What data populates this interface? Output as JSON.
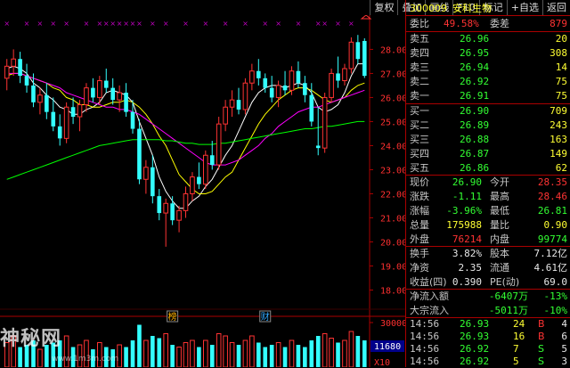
{
  "toolbar": {
    "buttons": [
      "复权",
      "叠加",
      "画线",
      "F10",
      "标记",
      "+自选",
      "返回"
    ]
  },
  "stock": {
    "code": "300009",
    "name": "安科生物"
  },
  "order_book": {
    "webi_label": "委比",
    "webi_value": "49.58%",
    "weicha_label": "委差",
    "weicha_value": "879",
    "asks": [
      {
        "label": "卖五",
        "price": "26.96",
        "vol": "20"
      },
      {
        "label": "卖四",
        "price": "26.95",
        "vol": "308"
      },
      {
        "label": "卖三",
        "price": "26.94",
        "vol": "14"
      },
      {
        "label": "卖二",
        "price": "26.92",
        "vol": "75"
      },
      {
        "label": "卖一",
        "price": "26.91",
        "vol": "75"
      }
    ],
    "bids": [
      {
        "label": "买一",
        "price": "26.90",
        "vol": "709"
      },
      {
        "label": "买二",
        "price": "26.89",
        "vol": "243"
      },
      {
        "label": "买三",
        "price": "26.88",
        "vol": "163"
      },
      {
        "label": "买四",
        "price": "26.87",
        "vol": "149"
      },
      {
        "label": "买五",
        "price": "26.86",
        "vol": "62"
      }
    ]
  },
  "quote": {
    "rows": [
      {
        "l1": "现价",
        "v1": "26.90",
        "l2": "今开",
        "v2": "28.35"
      },
      {
        "l1": "涨跌",
        "v1": "-1.11",
        "l2": "最高",
        "v2": "28.46"
      },
      {
        "l1": "涨幅",
        "v1": "-3.96%",
        "l2": "最低",
        "v2": "26.81"
      },
      {
        "l1": "总量",
        "v1": "175988",
        "l2": "量比",
        "v2": "0.90"
      },
      {
        "l1": "外盘",
        "v1": "76214",
        "l2": "内盘",
        "v2": "99774"
      }
    ]
  },
  "fundamentals": {
    "rows": [
      {
        "l1": "换手",
        "v1": "3.82%",
        "l2": "股本",
        "v2": "7.12亿"
      },
      {
        "l1": "净资",
        "v1": "2.35",
        "l2": "流通",
        "v2": "4.61亿"
      },
      {
        "l1": "收益(四)",
        "v1": "0.390",
        "l2": "PE(动)",
        "v2": "69.0"
      }
    ]
  },
  "flows": {
    "rows": [
      {
        "label": "净流入额",
        "value": "-6407万",
        "pct": "-13%"
      },
      {
        "label": "大宗流入",
        "value": "-5011万",
        "pct": "-10%"
      }
    ]
  },
  "ticks": [
    {
      "time": "14:56",
      "price": "26.93",
      "vol": "24",
      "side": "B",
      "n": "4"
    },
    {
      "time": "14:56",
      "price": "26.93",
      "vol": "16",
      "side": "B",
      "n": "6"
    },
    {
      "time": "14:56",
      "price": "26.92",
      "vol": "7",
      "side": "S",
      "n": "5"
    },
    {
      "time": "14:56",
      "price": "26.92",
      "vol": "5",
      "side": "S",
      "n": "3"
    }
  ],
  "price_axis": [
    "28.00",
    "27.00",
    "26.00",
    "25.00",
    "24.00",
    "23.00",
    "22.00",
    "21.00",
    "20.00",
    "19.00",
    "18.00"
  ],
  "volume_axis": [
    "30000",
    "11680",
    "X10"
  ],
  "event_markers": [
    "榜",
    "财"
  ],
  "watermark": {
    "main": "神秘网",
    "sub": "www.1m3m.com"
  },
  "colors": {
    "up": "#ff3333",
    "down": "#33ffff",
    "ma5": "#ffffff",
    "ma10": "#ffff00",
    "ma20": "#ff00ff",
    "ma60": "#00ff00"
  },
  "chart_data": {
    "type": "candlestick",
    "ylim": [
      17.5,
      29.2
    ],
    "candles": [
      {
        "o": 26.8,
        "h": 27.6,
        "l": 26.3,
        "c": 27.3
      },
      {
        "o": 27.3,
        "h": 28.0,
        "l": 26.9,
        "c": 27.6
      },
      {
        "o": 27.6,
        "h": 27.9,
        "l": 26.6,
        "c": 26.9
      },
      {
        "o": 26.9,
        "h": 27.4,
        "l": 26.2,
        "c": 26.5
      },
      {
        "o": 26.5,
        "h": 27.0,
        "l": 25.6,
        "c": 25.8
      },
      {
        "o": 25.8,
        "h": 26.4,
        "l": 25.3,
        "c": 26.1
      },
      {
        "o": 26.1,
        "h": 26.6,
        "l": 25.1,
        "c": 25.4
      },
      {
        "o": 25.4,
        "h": 26.0,
        "l": 24.6,
        "c": 24.8
      },
      {
        "o": 24.8,
        "h": 25.3,
        "l": 24.0,
        "c": 24.3
      },
      {
        "o": 24.3,
        "h": 25.8,
        "l": 24.1,
        "c": 25.6
      },
      {
        "o": 25.6,
        "h": 26.0,
        "l": 24.9,
        "c": 25.2
      },
      {
        "o": 25.2,
        "h": 25.9,
        "l": 24.6,
        "c": 25.7
      },
      {
        "o": 25.7,
        "h": 26.6,
        "l": 25.4,
        "c": 26.4
      },
      {
        "o": 26.4,
        "h": 26.8,
        "l": 25.8,
        "c": 26.0
      },
      {
        "o": 26.0,
        "h": 26.9,
        "l": 25.7,
        "c": 26.7
      },
      {
        "o": 26.7,
        "h": 27.2,
        "l": 26.2,
        "c": 26.4
      },
      {
        "o": 26.4,
        "h": 26.8,
        "l": 25.7,
        "c": 25.9
      },
      {
        "o": 25.9,
        "h": 26.5,
        "l": 25.4,
        "c": 26.2
      },
      {
        "o": 26.2,
        "h": 26.6,
        "l": 25.2,
        "c": 25.4
      },
      {
        "o": 25.4,
        "h": 25.9,
        "l": 24.5,
        "c": 24.7
      },
      {
        "o": 24.7,
        "h": 25.1,
        "l": 22.4,
        "c": 22.6
      },
      {
        "o": 22.6,
        "h": 23.4,
        "l": 22.0,
        "c": 23.1
      },
      {
        "o": 23.1,
        "h": 23.6,
        "l": 21.6,
        "c": 21.9
      },
      {
        "o": 21.9,
        "h": 22.2,
        "l": 20.9,
        "c": 21.2
      },
      {
        "o": 21.2,
        "h": 21.8,
        "l": 19.8,
        "c": 21.6
      },
      {
        "o": 21.6,
        "h": 21.9,
        "l": 20.7,
        "c": 20.9
      },
      {
        "o": 20.9,
        "h": 21.5,
        "l": 20.4,
        "c": 21.3
      },
      {
        "o": 21.3,
        "h": 22.3,
        "l": 21.0,
        "c": 22.0
      },
      {
        "o": 22.0,
        "h": 22.9,
        "l": 21.7,
        "c": 22.7
      },
      {
        "o": 22.7,
        "h": 23.3,
        "l": 22.2,
        "c": 22.4
      },
      {
        "o": 22.4,
        "h": 23.8,
        "l": 22.2,
        "c": 23.6
      },
      {
        "o": 23.6,
        "h": 24.2,
        "l": 23.0,
        "c": 23.2
      },
      {
        "o": 23.2,
        "h": 25.2,
        "l": 23.0,
        "c": 24.9
      },
      {
        "o": 24.9,
        "h": 25.9,
        "l": 24.6,
        "c": 25.6
      },
      {
        "o": 25.6,
        "h": 26.3,
        "l": 25.2,
        "c": 25.9
      },
      {
        "o": 25.9,
        "h": 26.4,
        "l": 25.3,
        "c": 25.5
      },
      {
        "o": 25.5,
        "h": 26.8,
        "l": 25.3,
        "c": 26.6
      },
      {
        "o": 26.6,
        "h": 27.4,
        "l": 26.3,
        "c": 27.1
      },
      {
        "o": 27.1,
        "h": 27.6,
        "l": 26.5,
        "c": 26.8
      },
      {
        "o": 26.8,
        "h": 27.0,
        "l": 26.2,
        "c": 26.4
      },
      {
        "o": 26.4,
        "h": 26.9,
        "l": 25.8,
        "c": 26.0
      },
      {
        "o": 26.0,
        "h": 26.7,
        "l": 25.6,
        "c": 26.5
      },
      {
        "o": 26.5,
        "h": 27.1,
        "l": 26.1,
        "c": 26.3
      },
      {
        "o": 26.3,
        "h": 27.3,
        "l": 26.1,
        "c": 27.1
      },
      {
        "o": 27.1,
        "h": 27.5,
        "l": 26.4,
        "c": 26.6
      },
      {
        "o": 26.6,
        "h": 26.9,
        "l": 25.8,
        "c": 26.1
      },
      {
        "o": 26.1,
        "h": 26.6,
        "l": 24.8,
        "c": 25.0
      },
      {
        "o": 24.0,
        "h": 25.6,
        "l": 23.6,
        "c": 23.9
      },
      {
        "o": 23.9,
        "h": 26.2,
        "l": 23.7,
        "c": 26.0
      },
      {
        "o": 26.0,
        "h": 27.2,
        "l": 25.8,
        "c": 27.0
      },
      {
        "o": 27.0,
        "h": 27.7,
        "l": 26.4,
        "c": 26.7
      },
      {
        "o": 26.7,
        "h": 27.4,
        "l": 26.5,
        "c": 27.2
      },
      {
        "o": 27.2,
        "h": 28.5,
        "l": 27.0,
        "c": 28.3
      },
      {
        "o": 28.3,
        "h": 28.6,
        "l": 27.4,
        "c": 27.6
      },
      {
        "o": 28.35,
        "h": 28.46,
        "l": 26.81,
        "c": 26.9
      }
    ],
    "volumes": [
      0.55,
      0.7,
      0.45,
      0.5,
      0.6,
      0.4,
      0.5,
      0.55,
      0.6,
      0.7,
      0.45,
      0.5,
      0.6,
      0.4,
      0.55,
      0.45,
      0.4,
      0.5,
      0.45,
      0.6,
      0.95,
      0.6,
      0.7,
      0.65,
      0.75,
      0.5,
      0.45,
      0.55,
      0.6,
      0.45,
      0.6,
      0.5,
      0.75,
      0.7,
      0.55,
      0.5,
      0.6,
      0.7,
      0.55,
      0.45,
      0.5,
      0.55,
      0.45,
      0.6,
      0.5,
      0.45,
      0.6,
      0.7,
      0.75,
      0.65,
      0.55,
      0.6,
      0.8,
      0.7,
      0.6
    ],
    "ma": [
      {
        "name": "MA5",
        "color": "#ffffff",
        "values": [
          27.2,
          27.3,
          27.2,
          27.0,
          26.6,
          26.4,
          26.1,
          25.9,
          25.6,
          25.5,
          25.3,
          25.3,
          25.5,
          25.6,
          25.8,
          26.2,
          26.3,
          26.2,
          26.1,
          25.8,
          25.0,
          24.3,
          23.6,
          22.7,
          22.1,
          21.7,
          21.4,
          21.4,
          21.7,
          21.9,
          22.3,
          22.6,
          23.1,
          23.6,
          24.0,
          24.6,
          25.2,
          25.8,
          26.2,
          26.4,
          26.5,
          26.5,
          26.4,
          26.5,
          26.6,
          26.5,
          26.2,
          25.6,
          25.4,
          25.5,
          25.7,
          26.2,
          26.9,
          27.4,
          27.4
        ]
      },
      {
        "name": "MA10",
        "color": "#ffff00",
        "values": [
          26.9,
          27.0,
          27.0,
          26.9,
          26.8,
          26.7,
          26.6,
          26.4,
          26.3,
          26.0,
          25.9,
          25.7,
          25.7,
          25.6,
          25.6,
          25.7,
          25.8,
          25.8,
          25.9,
          25.8,
          25.6,
          25.3,
          24.9,
          24.4,
          24.0,
          23.4,
          22.8,
          22.5,
          22.2,
          22.0,
          22.0,
          22.1,
          22.4,
          22.7,
          22.9,
          23.4,
          23.9,
          24.4,
          24.9,
          25.3,
          25.6,
          25.9,
          26.1,
          26.3,
          26.4,
          26.4,
          26.3,
          26.1,
          25.9,
          25.8,
          25.9,
          26.0,
          26.3,
          26.5,
          26.6
        ]
      },
      {
        "name": "MA20",
        "color": "#ff00ff",
        "values": [
          27.0,
          27.0,
          27.0,
          26.9,
          26.8,
          26.7,
          26.6,
          26.5,
          26.4,
          26.2,
          26.1,
          26.0,
          25.9,
          25.8,
          25.7,
          25.6,
          25.6,
          25.5,
          25.5,
          25.4,
          25.3,
          25.1,
          24.9,
          24.7,
          24.5,
          24.3,
          24.1,
          23.9,
          23.7,
          23.5,
          23.3,
          23.2,
          23.2,
          23.2,
          23.3,
          23.4,
          23.6,
          23.8,
          24.0,
          24.3,
          24.5,
          24.8,
          25.0,
          25.2,
          25.4,
          25.5,
          25.6,
          25.6,
          25.7,
          25.8,
          25.9,
          26.0,
          26.1,
          26.2,
          26.3
        ]
      },
      {
        "name": "MA60",
        "color": "#00ff00",
        "values": [
          22.6,
          22.7,
          22.8,
          22.9,
          23.0,
          23.1,
          23.2,
          23.3,
          23.4,
          23.5,
          23.6,
          23.7,
          23.8,
          23.9,
          24.0,
          24.05,
          24.1,
          24.15,
          24.2,
          24.25,
          24.25,
          24.25,
          24.25,
          24.25,
          24.2,
          24.2,
          24.15,
          24.1,
          24.1,
          24.05,
          24.05,
          24.05,
          24.1,
          24.1,
          24.15,
          24.2,
          24.25,
          24.3,
          24.35,
          24.4,
          24.45,
          24.5,
          24.55,
          24.6,
          24.65,
          24.7,
          24.7,
          24.75,
          24.8,
          24.8,
          24.85,
          24.9,
          24.95,
          25.0,
          25.0
        ]
      }
    ]
  }
}
